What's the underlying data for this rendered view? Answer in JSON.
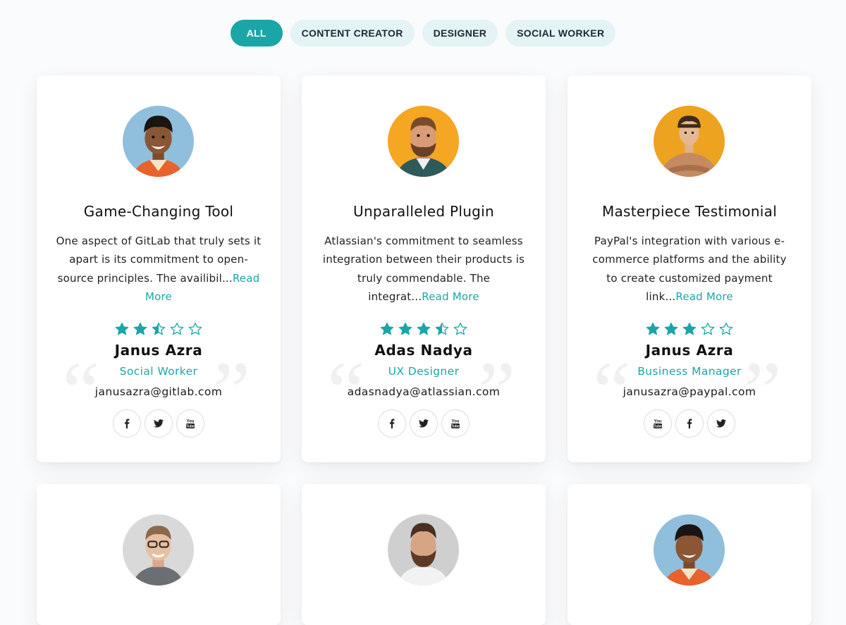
{
  "filters": [
    "ALL",
    "CONTENT CREATOR",
    "DESIGNER",
    "SOCIAL WORKER"
  ],
  "active_filter": "ALL",
  "colors": {
    "accent": "#1aa6a6",
    "filter_bg": "#e3f3f6"
  },
  "cards": [
    {
      "title": "Game-Changing Tool",
      "text": "One aspect of GitLab that truly sets it apart is its commitment to open-source principles. The availibil...",
      "read_more": "Read More",
      "rating": 2.5,
      "name": "Janus Azra",
      "role": "Social Worker",
      "email": "janusazra@gitlab.com",
      "socials": [
        "facebook-icon",
        "twitter-icon",
        "youtube-icon"
      ],
      "avatar_bg": "#8fbfdc"
    },
    {
      "title": "Unparalleled Plugin",
      "text": "Atlassian's commitment to seamless integration between their products is truly commendable. The integrat...",
      "read_more": "Read More",
      "rating": 3.5,
      "name": "Adas Nadya",
      "role": "UX Designer",
      "email": "adasnadya@atlassian.com",
      "socials": [
        "facebook-icon",
        "twitter-icon",
        "youtube-icon"
      ],
      "avatar_bg": "#f5a623"
    },
    {
      "title": "Masterpiece Testimonial",
      "text": "PayPal's integration with various e-commerce platforms and the ability to create customized payment link...",
      "read_more": "Read More",
      "rating": 3,
      "name": "Janus Azra",
      "role": "Business Manager",
      "email": "janusazra@paypal.com",
      "socials": [
        "youtube-icon",
        "facebook-icon",
        "twitter-icon"
      ],
      "avatar_bg": "#eda320"
    }
  ],
  "lower_cards": [
    {
      "avatar_bg": "#d9d9d9"
    },
    {
      "avatar_bg": "#cfcfcf"
    },
    {
      "avatar_bg": "#8fbfdc"
    }
  ]
}
